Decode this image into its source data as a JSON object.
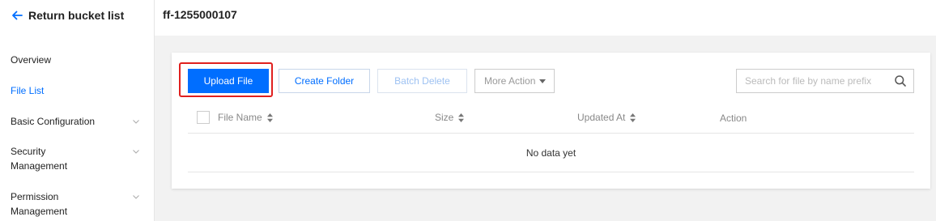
{
  "sidebar": {
    "back_label": "Return bucket list",
    "items": [
      {
        "label": "Overview"
      },
      {
        "label": "File List",
        "active": true
      },
      {
        "label": "Basic Configuration"
      },
      {
        "label": "Security",
        "label2": "Management"
      },
      {
        "label": "Permission",
        "label2": "Management"
      }
    ]
  },
  "header": {
    "bucket_name": "ff-1255000107"
  },
  "toolbar": {
    "upload_label": "Upload File",
    "create_folder_label": "Create Folder",
    "batch_delete_label": "Batch Delete",
    "more_action_label": "More Action"
  },
  "search": {
    "placeholder": "Search for file by name prefix"
  },
  "table": {
    "columns": [
      "File Name",
      "Size",
      "Updated At",
      "Action"
    ],
    "empty_text": "No data yet"
  },
  "colors": {
    "accent": "#006eff",
    "highlight": "#e0201f"
  }
}
